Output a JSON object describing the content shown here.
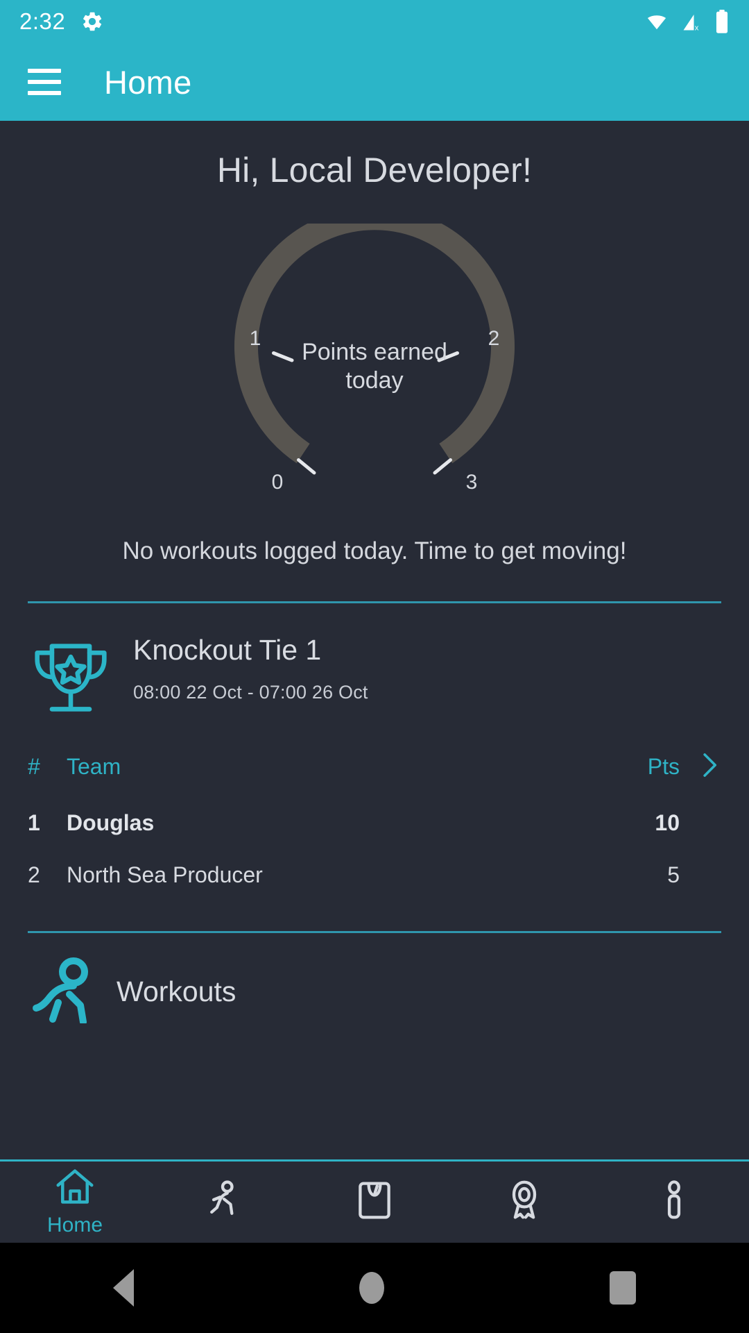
{
  "status_bar": {
    "time": "2:32",
    "icons": [
      "gear-icon",
      "wifi-icon",
      "cellular-no-signal-icon",
      "battery-icon"
    ]
  },
  "app_bar": {
    "menu_icon": "hamburger-menu-icon",
    "title": "Home"
  },
  "main": {
    "greeting": "Hi, Local Developer!",
    "gauge": {
      "center_line1": "Points earned",
      "center_line2": "today",
      "tick_labels": [
        "0",
        "1",
        "2",
        "3"
      ],
      "min": 0,
      "max": 3,
      "value": 0,
      "track_color": "#585550",
      "progress_color": "#2bb5c8"
    },
    "empty_state": "No workouts logged today. Time to get moving!"
  },
  "competition": {
    "icon": "trophy-icon",
    "title": "Knockout Tie 1",
    "dates": "08:00 22 Oct  -  07:00 26 Oct",
    "leaderboard": {
      "columns": [
        "#",
        "Team",
        "Pts"
      ],
      "chevron": "chevron-right-icon",
      "rows": [
        {
          "rank": "1",
          "team": "Douglas",
          "pts": "10"
        },
        {
          "rank": "2",
          "team": "North Sea Producer",
          "pts": "5"
        }
      ]
    }
  },
  "workouts_section": {
    "icon": "runner-icon",
    "title": "Workouts"
  },
  "bottom_nav": {
    "items": [
      {
        "icon": "home-icon",
        "label": "Home",
        "active": true
      },
      {
        "icon": "runner-icon",
        "label": "",
        "active": false
      },
      {
        "icon": "scale-icon",
        "label": "",
        "active": false
      },
      {
        "icon": "award-icon",
        "label": "",
        "active": false
      },
      {
        "icon": "info-icon",
        "label": "",
        "active": false
      }
    ]
  },
  "system_nav": {
    "buttons": [
      "back-button",
      "home-button",
      "recents-button"
    ]
  },
  "colors": {
    "accent": "#2bb5c8",
    "background": "#272b36",
    "text_primary": "#d9dce2",
    "divider": "#2f96ad"
  }
}
